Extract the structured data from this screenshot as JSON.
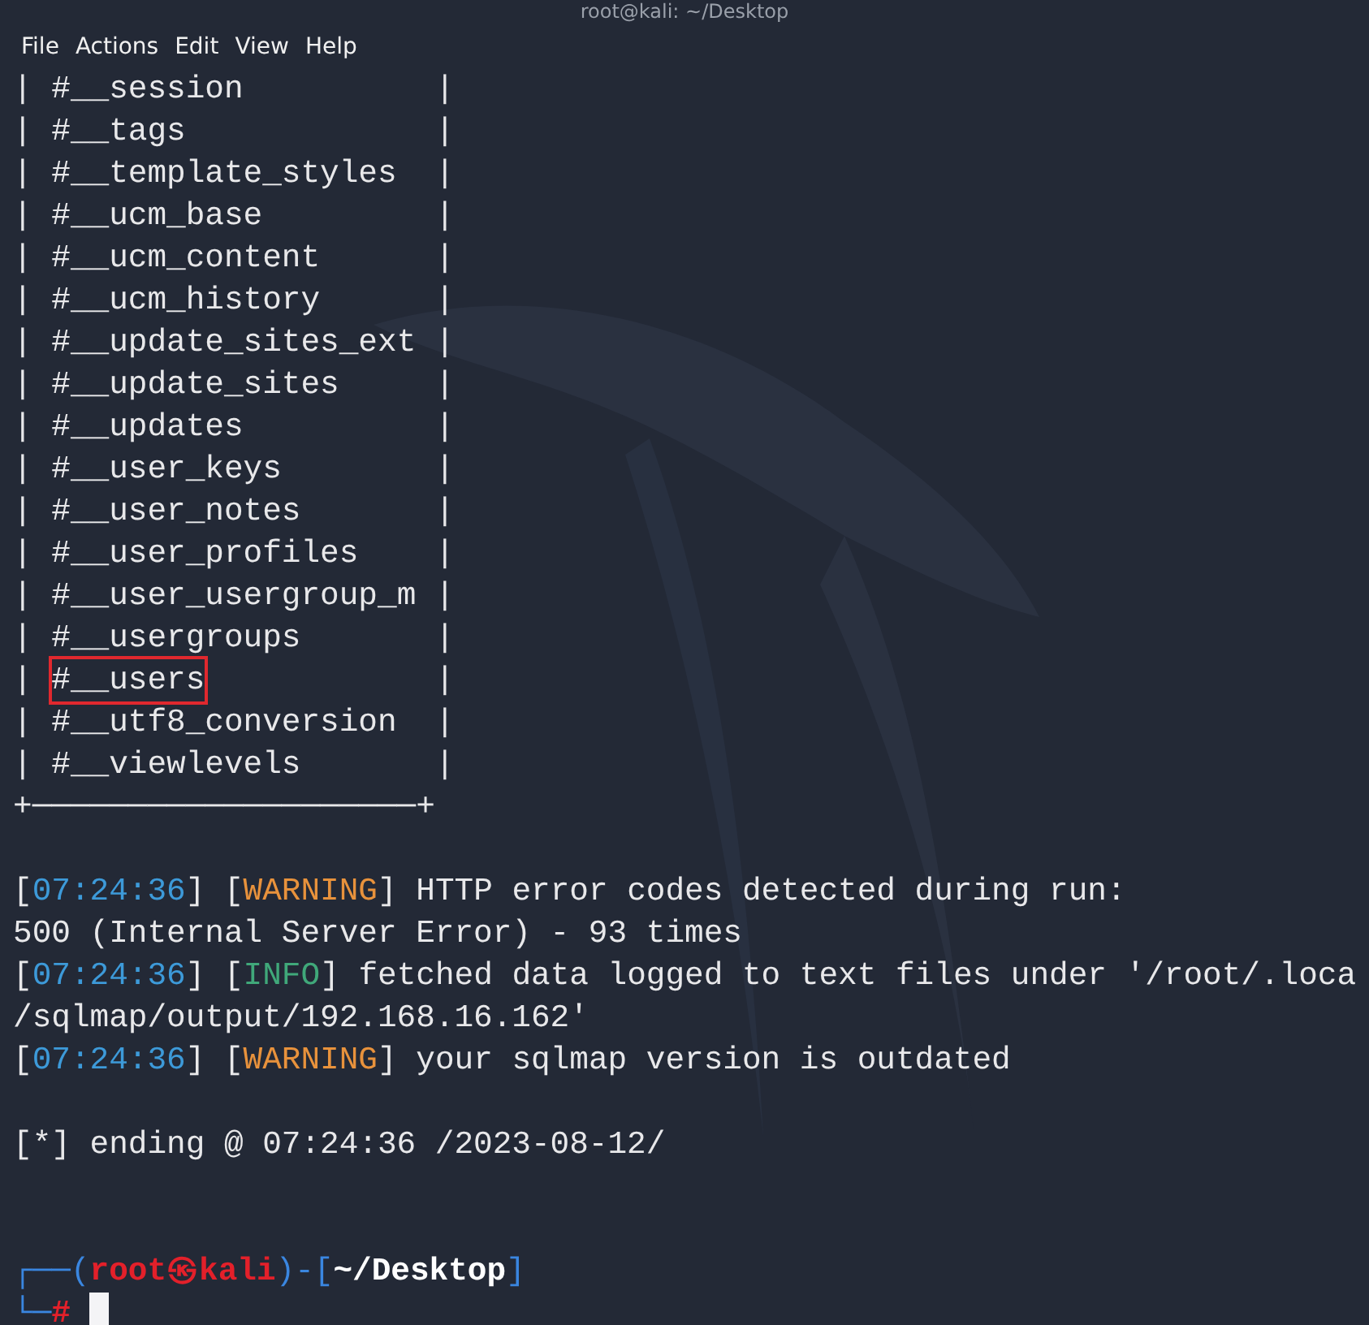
{
  "window": {
    "title": "root@kali: ~/Desktop"
  },
  "menu": [
    "File",
    "Actions",
    "Edit",
    "View",
    "Help"
  ],
  "table": {
    "edge": "|",
    "bottom_border": "+────────────────────+",
    "rows": [
      {
        "name": "#__session",
        "highlighted": false
      },
      {
        "name": "#__tags",
        "highlighted": false
      },
      {
        "name": "#__template_styles",
        "highlighted": false
      },
      {
        "name": "#__ucm_base",
        "highlighted": false
      },
      {
        "name": "#__ucm_content",
        "highlighted": false
      },
      {
        "name": "#__ucm_history",
        "highlighted": false
      },
      {
        "name": "#__update_sites_ext",
        "highlighted": false
      },
      {
        "name": "#__update_sites",
        "highlighted": false
      },
      {
        "name": "#__updates",
        "highlighted": false
      },
      {
        "name": "#__user_keys",
        "highlighted": false
      },
      {
        "name": "#__user_notes",
        "highlighted": false
      },
      {
        "name": "#__user_profiles",
        "highlighted": false
      },
      {
        "name": "#__user_usergroup_m",
        "highlighted": false
      },
      {
        "name": "#__usergroups",
        "highlighted": false
      },
      {
        "name": "#__users",
        "highlighted": true
      },
      {
        "name": "#__utf8_conversion",
        "highlighted": false
      },
      {
        "name": "#__viewlevels",
        "highlighted": false
      }
    ]
  },
  "log": [
    {
      "kind": "blank"
    },
    {
      "kind": "text",
      "segments": [
        {
          "text": "[",
          "kind": "plain"
        },
        {
          "text": "07:24:36",
          "kind": "time"
        },
        {
          "text": "] [",
          "kind": "plain"
        },
        {
          "text": "WARNING",
          "kind": "warning"
        },
        {
          "text": "] HTTP error codes detected during run:",
          "kind": "plain"
        }
      ]
    },
    {
      "kind": "text",
      "segments": [
        {
          "text": "500 (Internal Server Error) - 93 times",
          "kind": "plain"
        }
      ]
    },
    {
      "kind": "text",
      "segments": [
        {
          "text": "[",
          "kind": "plain"
        },
        {
          "text": "07:24:36",
          "kind": "time"
        },
        {
          "text": "] [",
          "kind": "plain"
        },
        {
          "text": "INFO",
          "kind": "info"
        },
        {
          "text": "] fetched data logged to text files under '/root/.loca",
          "kind": "plain"
        }
      ]
    },
    {
      "kind": "text",
      "segments": [
        {
          "text": "/sqlmap/output/192.168.16.162'",
          "kind": "plain"
        }
      ]
    },
    {
      "kind": "text",
      "segments": [
        {
          "text": "[",
          "kind": "plain"
        },
        {
          "text": "07:24:36",
          "kind": "time"
        },
        {
          "text": "] [",
          "kind": "plain"
        },
        {
          "text": "WARNING",
          "kind": "warning"
        },
        {
          "text": "] your sqlmap version is outdated",
          "kind": "plain"
        }
      ]
    },
    {
      "kind": "blank"
    },
    {
      "kind": "text",
      "segments": [
        {
          "text": "[*] ending @ 07:24:36 /2023-08-12/",
          "kind": "plain"
        }
      ]
    },
    {
      "kind": "blank"
    },
    {
      "kind": "blank"
    }
  ],
  "prompt": {
    "lines": [
      [
        {
          "text": "┌──(",
          "kind": "frame"
        },
        {
          "text": "root㉿kali",
          "kind": "user"
        },
        {
          "text": ")-[",
          "kind": "frame"
        },
        {
          "text": "~/Desktop",
          "kind": "path"
        },
        {
          "text": "]",
          "kind": "frame"
        }
      ],
      [
        {
          "text": "└─",
          "kind": "frame"
        },
        {
          "text": "#",
          "kind": "user"
        }
      ]
    ],
    "cursor": true
  }
}
